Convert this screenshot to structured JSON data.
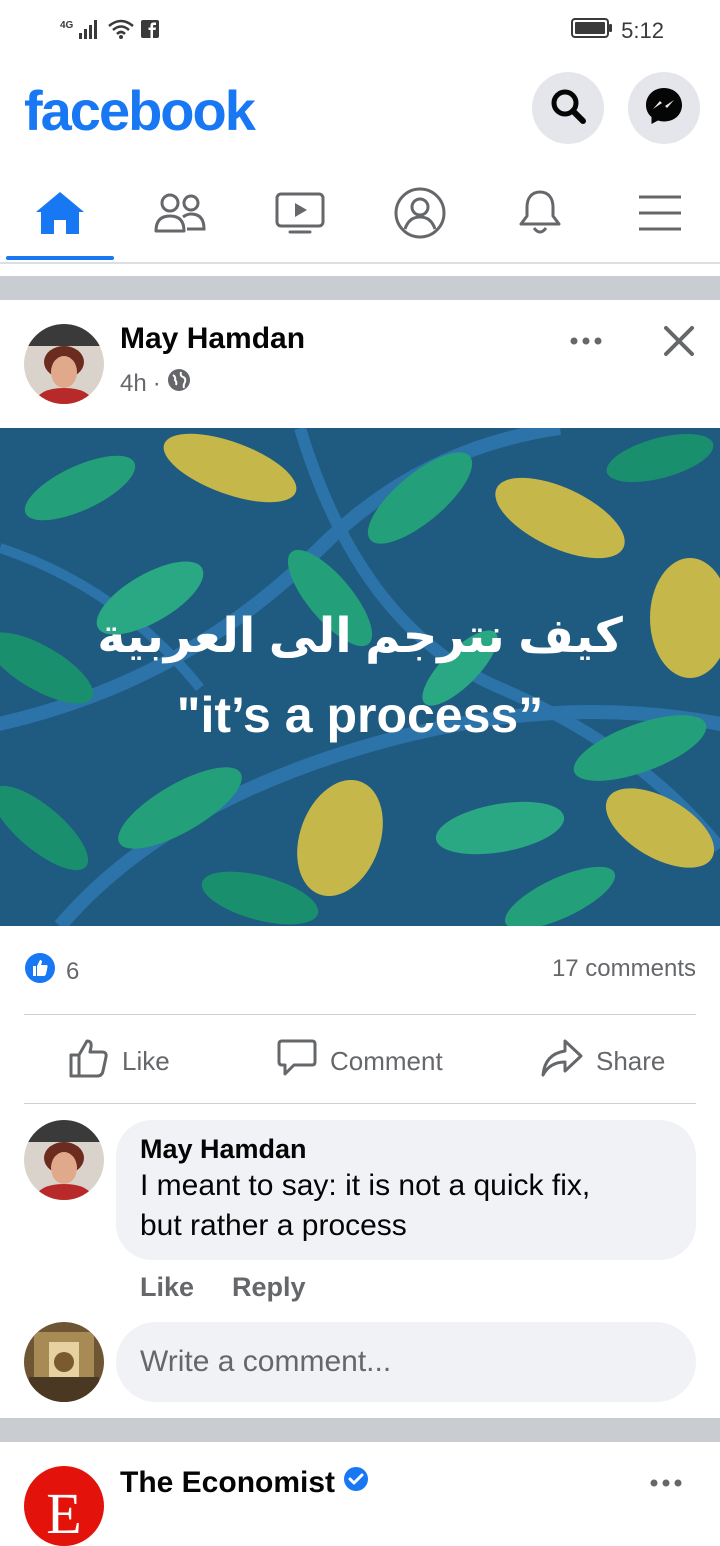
{
  "status_bar": {
    "network": "4G",
    "time": "5:12",
    "icons": [
      "signal-icon",
      "wifi-icon",
      "facebook-notification-icon",
      "battery-icon"
    ]
  },
  "header": {
    "logo": "facebook",
    "icons": [
      "search-icon",
      "messenger-icon"
    ],
    "brand_color": "#1877f2"
  },
  "tabs": [
    "home-icon",
    "friends-icon",
    "watch-icon",
    "profile-icon",
    "notifications-icon",
    "menu-icon"
  ],
  "post": {
    "author": "May Hamdan",
    "time": "4h",
    "separator": "·",
    "image_text_arabic": "كيف نترجم الى العربية",
    "image_text_english": "\"it’s a process”",
    "reaction_count": "6",
    "comments_count": "17 comments",
    "actions": {
      "like": "Like",
      "comment": "Comment",
      "share": "Share"
    },
    "comment": {
      "author": "May Hamdan",
      "text_line1": "I meant to say: it is not a quick fix,",
      "text_line2": "but rather a process",
      "like": "Like",
      "reply": "Reply"
    },
    "write_placeholder": "Write a comment..."
  },
  "next_post": {
    "author": "The Economist",
    "avatar_letter": "E"
  }
}
